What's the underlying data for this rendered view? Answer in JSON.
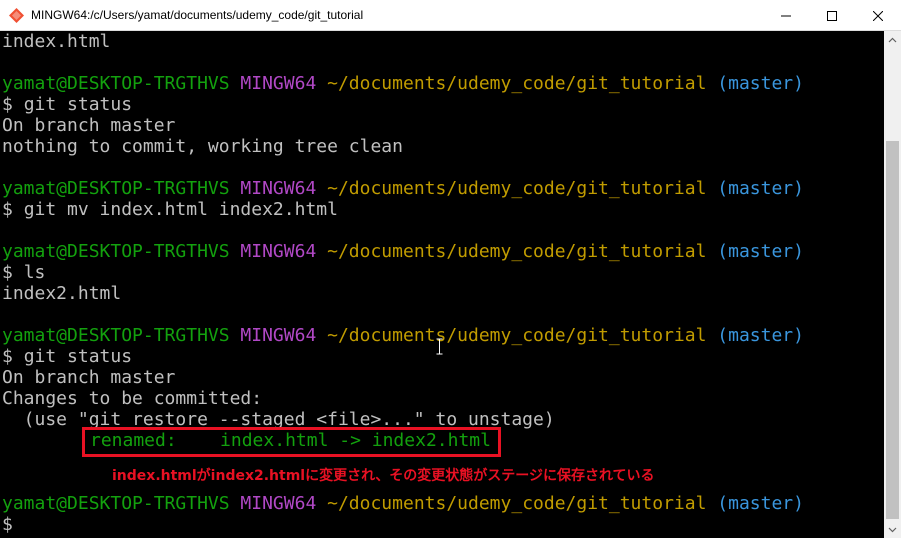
{
  "window": {
    "title": "MINGW64:/c/Users/yamat/documents/udemy_code/git_tutorial",
    "icon": "mingw-icon",
    "controls": [
      "minimize-icon",
      "maximize-icon",
      "close-icon"
    ]
  },
  "terminal": {
    "prompt_user": "yamat@DESKTOP-TRGTHVS",
    "prompt_system": "MINGW64",
    "prompt_path": "~/documents/udemy_code/git_tutorial",
    "prompt_branch": "(master)",
    "prompt_symbol": "$",
    "lines": {
      "l0": "index.html",
      "cmd_status1": "git status",
      "out_branch1": "On branch master",
      "out_clean": "nothing to commit, working tree clean",
      "cmd_mv": "git mv index.html index2.html",
      "cmd_ls": "ls",
      "out_ls": "index2.html",
      "cmd_status2": "git status",
      "out_branch2": "On branch master",
      "out_changes": "Changes to be committed:",
      "out_hint": "  (use \"git restore --staged <file>...\" to unstage)",
      "out_renamed": "renamed:    index.html -> index2.html"
    }
  },
  "annotation": {
    "text": "index.htmlがindex2.htmlに変更され、その変更状態がステージに保存されている",
    "color": "#e81123"
  },
  "colors": {
    "user": "#13a10e",
    "system": "#b148c6",
    "path": "#c19c00",
    "branch": "#3a96dd",
    "text": "#c0c0c0"
  }
}
